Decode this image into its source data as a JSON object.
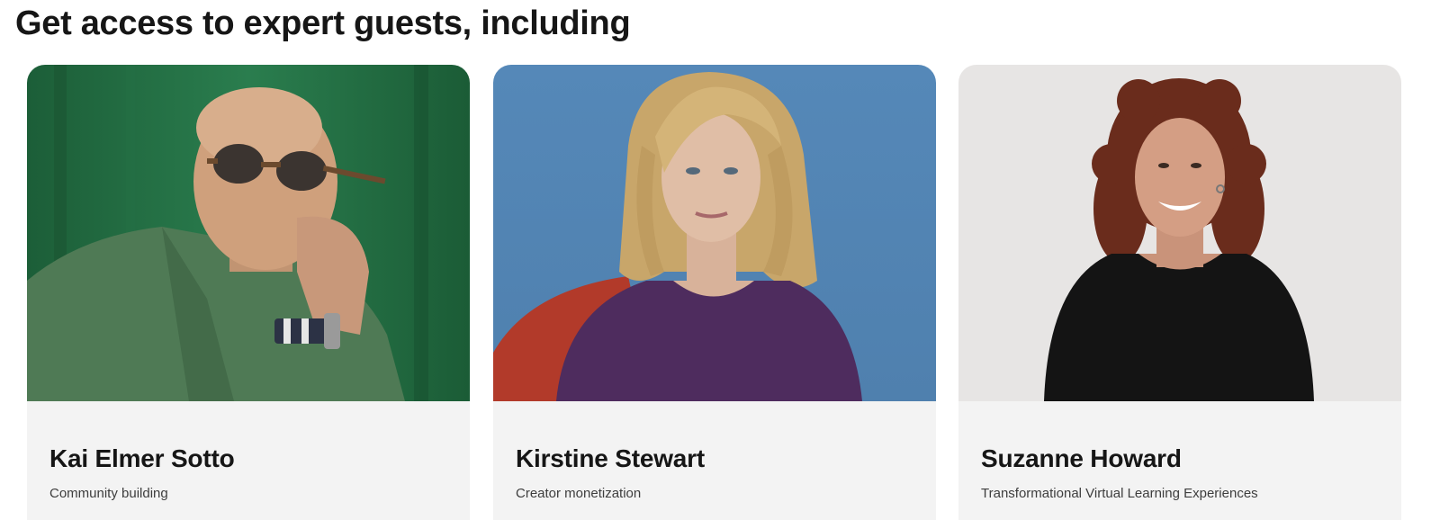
{
  "section": {
    "title": "Get access to expert guests, including"
  },
  "guests": [
    {
      "name": "Kai Elmer Sotto",
      "topic": "Community building",
      "photo_icon": "portrait-man-sunglasses-green-backdrop",
      "bg_color": "#1f6b40"
    },
    {
      "name": "Kirstine Stewart",
      "topic": "Creator monetization",
      "photo_icon": "portrait-woman-blonde-blue-backdrop",
      "bg_color": "#5a8ab8"
    },
    {
      "name": "Suzanne Howard",
      "topic": "Transformational Virtual Learning Experiences",
      "photo_icon": "portrait-woman-curly-hair-grey-backdrop",
      "bg_color": "#e6e4e3"
    }
  ]
}
